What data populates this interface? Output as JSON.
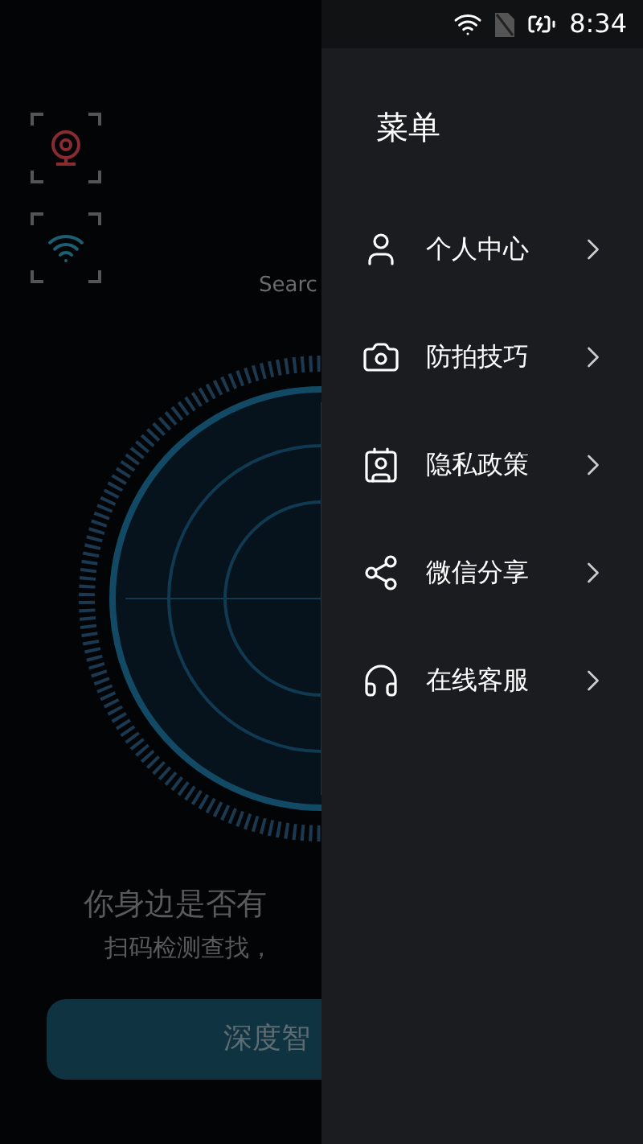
{
  "status_bar": {
    "time": "8:34"
  },
  "background_app": {
    "search_label": "Searc",
    "headline": "你身边是否有",
    "subline": "扫码检测查找，",
    "button": "深度智"
  },
  "drawer": {
    "title": "菜单",
    "items": [
      {
        "kind": "user",
        "label": "个人中心"
      },
      {
        "kind": "camera",
        "label": "防拍技巧"
      },
      {
        "kind": "privacy",
        "label": "隐私政策"
      },
      {
        "kind": "share",
        "label": "微信分享"
      },
      {
        "kind": "support",
        "label": "在线客服"
      }
    ]
  }
}
